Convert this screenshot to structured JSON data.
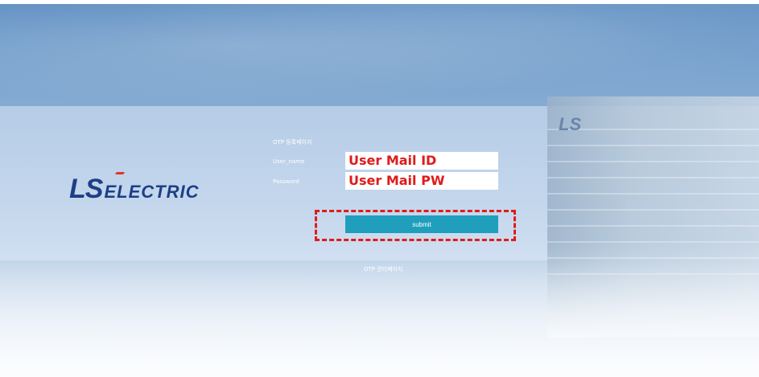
{
  "brand": {
    "logo_ls": "LS",
    "logo_electric": "ELECTRIC",
    "building_mark": "LS"
  },
  "form": {
    "title": "OTP 등록페이지",
    "username_label": "User_name",
    "password_label": "Password",
    "username_value": "User Mail ID",
    "password_value": "User Mail PW",
    "submit_label": "submit"
  },
  "footer": {
    "manage_link": "OTP 관리페이지"
  },
  "colors": {
    "accent": "#1f9fbc",
    "highlight": "#e21a1a",
    "logo": "#1d3f86"
  }
}
